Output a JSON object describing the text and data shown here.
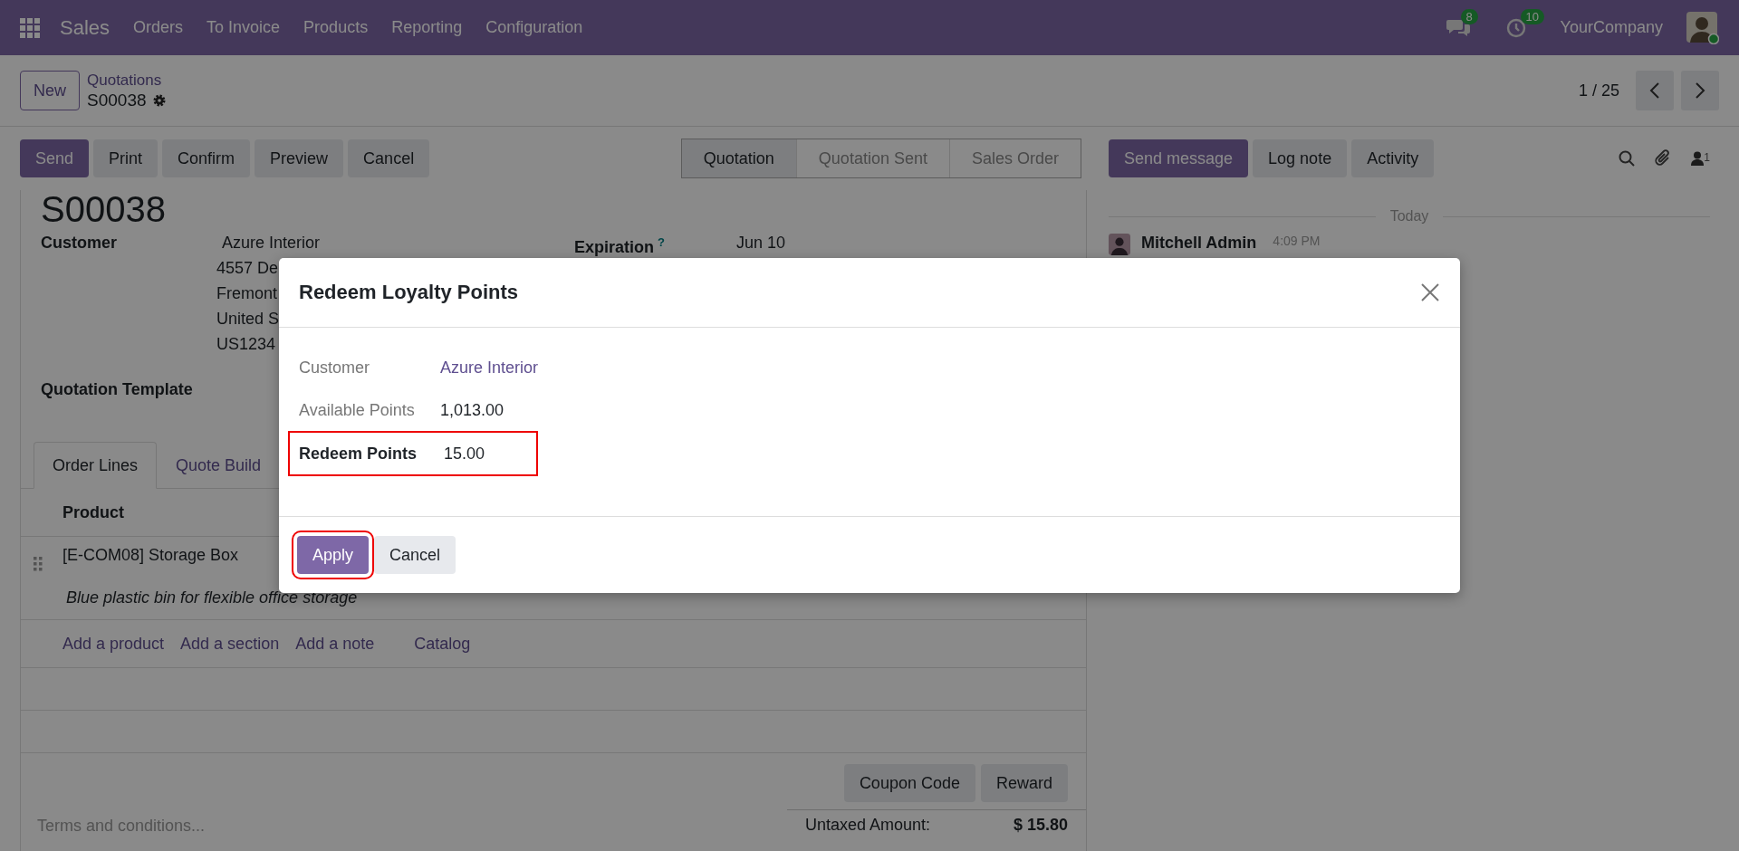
{
  "navbar": {
    "app": "Sales",
    "menus": [
      "Orders",
      "To Invoice",
      "Products",
      "Reporting",
      "Configuration"
    ],
    "messages_badge": "8",
    "activities_badge": "10",
    "company": "YourCompany"
  },
  "control_panel": {
    "new_button": "New",
    "breadcrumb": "Quotations",
    "record": "S00038",
    "pager": "1 / 25"
  },
  "actions": [
    {
      "label": "Send",
      "primary": true
    },
    {
      "label": "Print",
      "primary": false
    },
    {
      "label": "Confirm",
      "primary": false
    },
    {
      "label": "Preview",
      "primary": false
    },
    {
      "label": "Cancel",
      "primary": false
    }
  ],
  "status_steps": [
    {
      "label": "Quotation",
      "selected": true
    },
    {
      "label": "Quotation Sent",
      "selected": false
    },
    {
      "label": "Sales Order",
      "selected": false
    }
  ],
  "chatter_buttons": [
    {
      "label": "Send message",
      "primary": true
    },
    {
      "label": "Log note",
      "primary": false
    },
    {
      "label": "Activity",
      "primary": false
    }
  ],
  "followers_count": "1",
  "form": {
    "title": "S00038",
    "customer_label": "Customer",
    "customer_lines": [
      "Azure Interior",
      "4557 De",
      "Fremont",
      "United S",
      "US1234"
    ],
    "expiration_label": "Expiration",
    "expiration_help": "?",
    "expiration_value": "Jun 10",
    "template_label": "Quotation Template",
    "tabs": [
      {
        "label": "Order Lines",
        "selected": true
      },
      {
        "label": "Quote Build",
        "selected": false
      }
    ],
    "product_header": "Product",
    "lines": [
      {
        "name": "[E-COM08] Storage Box",
        "description": "Blue plastic bin for flexible office storage"
      }
    ],
    "add_links": [
      "Add a product",
      "Add a section",
      "Add a note",
      "Catalog"
    ],
    "bottom_buttons": [
      "Coupon Code",
      "Reward"
    ],
    "terms_placeholder": "Terms and conditions...",
    "totals": [
      {
        "label": "Untaxed Amount:",
        "value": "$ 15.80"
      }
    ]
  },
  "chatter": {
    "date_divider": "Today",
    "messages": [
      {
        "author": "Mitchell Admin",
        "time": "4:09 PM"
      }
    ]
  },
  "dialog": {
    "title": "Redeem Loyalty Points",
    "fields": [
      {
        "label": "Customer",
        "value": "Azure Interior",
        "kind": "link",
        "highlighted": false
      },
      {
        "label": "Available Points",
        "value": "1,013.00",
        "kind": "text",
        "highlighted": false
      },
      {
        "label": "Redeem Points",
        "value": "15.00",
        "kind": "input",
        "highlighted": true
      }
    ],
    "buttons": [
      {
        "label": "Apply",
        "primary": true,
        "highlighted": true
      },
      {
        "label": "Cancel",
        "primary": false,
        "highlighted": false
      }
    ]
  }
}
